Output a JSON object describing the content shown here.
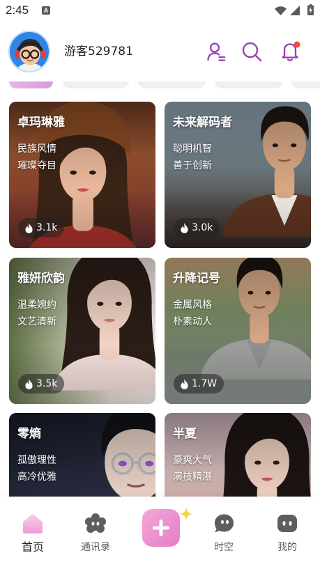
{
  "status_bar": {
    "time": "2:45",
    "notification_letter": "A",
    "icons": [
      "wifi-icon",
      "signal-icon",
      "battery-charging-icon"
    ]
  },
  "header": {
    "avatar_icon": "cartoon-avatar-icon",
    "username": "游客529781",
    "action_icons": [
      "contacts-user-icon",
      "search-icon",
      "bell-icon"
    ]
  },
  "cards": [
    {
      "title": "卓玛琳雅",
      "tags": [
        "民族风情",
        "璀璨夺目"
      ],
      "popularity": "3.1k",
      "popularity_icon": "fire-icon"
    },
    {
      "title": "未来解码者",
      "tags": [
        "聪明机智",
        "善于创新"
      ],
      "popularity": "3.0k",
      "popularity_icon": "fire-icon"
    },
    {
      "title": "雅妍欣韵",
      "tags": [
        "温柔婉约",
        "文艺清新"
      ],
      "popularity": "3.5k",
      "popularity_icon": "fire-icon"
    },
    {
      "title": "升降记号",
      "tags": [
        "金属风格",
        "朴素动人"
      ],
      "popularity": "1.7W",
      "popularity_icon": "fire-icon"
    },
    {
      "title": "零熵",
      "tags": [
        "孤傲理性",
        "高冷优雅"
      ]
    },
    {
      "title": "半夏",
      "tags": [
        "豪爽大气",
        "演技精湛"
      ]
    }
  ],
  "bottom_nav": {
    "items": [
      {
        "label": "首页",
        "icon": "home-icon",
        "active": true
      },
      {
        "label": "通讯录",
        "icon": "contacts-icon",
        "active": false
      },
      {
        "label": "时空",
        "icon": "chat-bubble-icon",
        "active": false
      },
      {
        "label": "我的",
        "icon": "profile-icon",
        "active": false
      }
    ],
    "create_button": {
      "icon": "plus-icon",
      "decoration_icon": "sparkle-icon"
    }
  },
  "theme": {
    "accent": "#9A3DB8",
    "badge_red": "#EF4B3F",
    "tab_active_start": "#E9B5E8",
    "tab_active_end": "#D89ADF",
    "tab_inactive": "#F0F0F0",
    "create_start": "#F4A8D8",
    "create_end": "#E17DC7",
    "home_start": "#F9CDEA",
    "home_end": "#EC9CD6",
    "nav_inactive": "#5E5E5E",
    "sparkle": "#F6D44A"
  }
}
